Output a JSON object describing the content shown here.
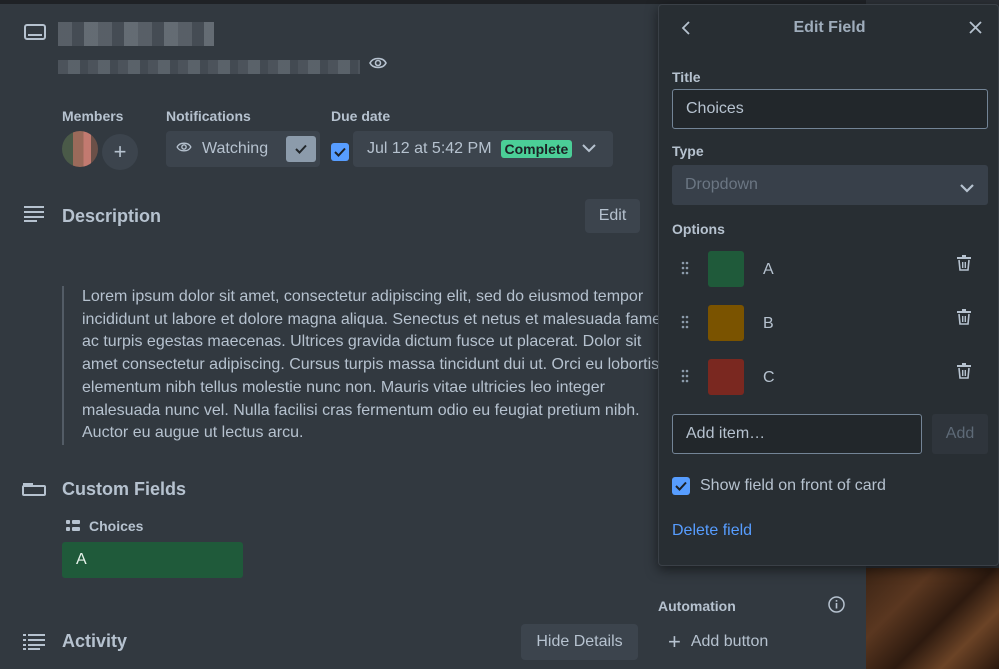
{
  "header": {},
  "labels": {
    "members": "Members",
    "notifications": "Notifications",
    "due_date": "Due date"
  },
  "notifications": {
    "watching": "Watching"
  },
  "due": {
    "text": "Jul 12 at 5:42 PM",
    "badge": "Complete"
  },
  "description": {
    "heading": "Description",
    "edit": "Edit",
    "body": "Lorem ipsum dolor sit amet, consectetur adipiscing elit, sed do eiusmod tempor incididunt ut labore et dolore magna aliqua. Senectus et netus et malesuada fames ac turpis egestas maecenas. Ultrices gravida dictum fusce ut placerat. Dolor sit amet consectetur adipiscing. Cursus turpis massa tincidunt dui ut. Orci eu lobortis elementum nibh tellus molestie nunc non. Mauris vitae ultricies leo integer malesuada nunc vel. Nulla facilisi cras fermentum odio eu feugiat pretium nibh. Auctor eu augue ut lectus arcu."
  },
  "custom_fields": {
    "heading": "Custom Fields",
    "field_name": "Choices",
    "field_value": "A"
  },
  "activity": {
    "heading": "Activity",
    "hide_details": "Hide Details"
  },
  "automation": {
    "label": "Automation",
    "add_button": "Add button"
  },
  "edit_field": {
    "title": "Edit Field",
    "title_label": "Title",
    "title_value": "Choices",
    "type_label": "Type",
    "type_value": "Dropdown",
    "options_label": "Options",
    "options": [
      {
        "label": "A",
        "color": "#1f5a3a"
      },
      {
        "label": "B",
        "color": "#7a5300"
      },
      {
        "label": "C",
        "color": "#7a2820"
      }
    ],
    "add_placeholder": "Add item…",
    "add_button": "Add",
    "show_on_front": "Show field on front of card",
    "delete_field": "Delete field"
  },
  "colors": {
    "accent": "#579dff",
    "complete_badge": "#4bce97",
    "field_value_bg": "#1f5a3a"
  }
}
